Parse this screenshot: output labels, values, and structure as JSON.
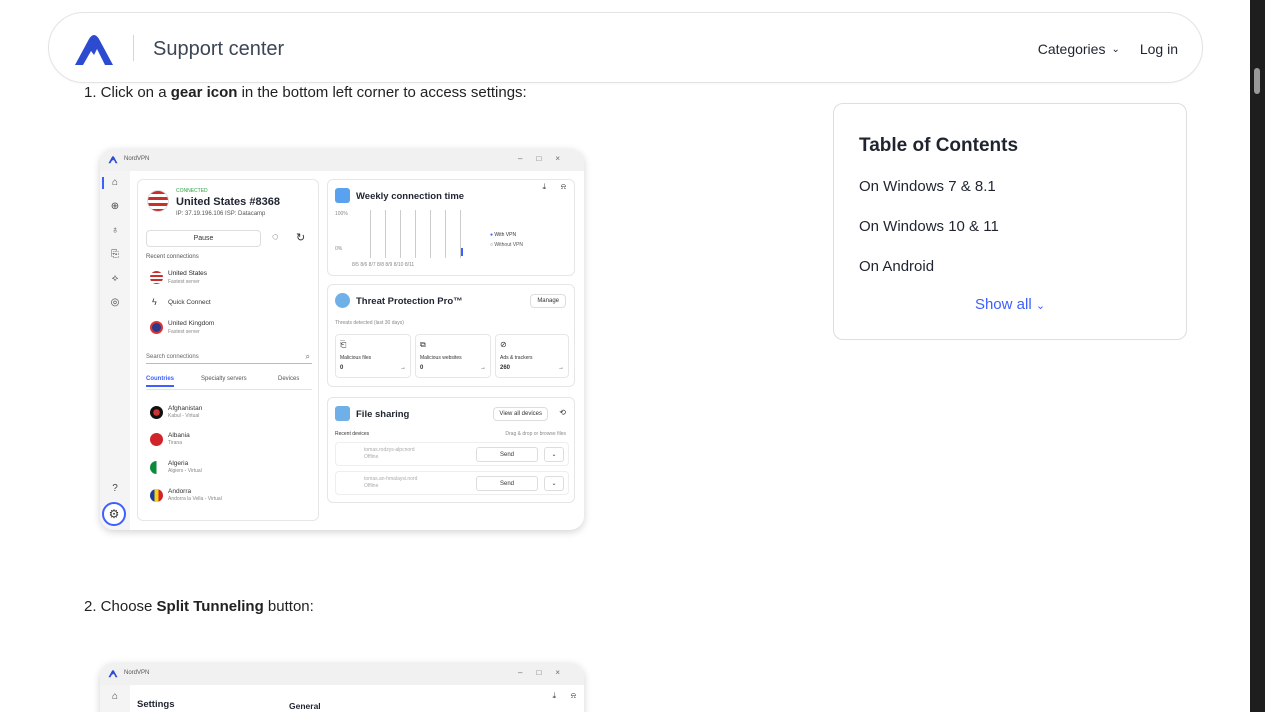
{
  "header": {
    "brand": "Support center",
    "categories": "Categories",
    "login": "Log in"
  },
  "steps": {
    "s1_pre": "1. Click on a ",
    "s1_bold": "gear icon",
    "s1_post": " in the bottom left corner to access settings:",
    "s2_pre": "2. Choose ",
    "s2_bold": "Split Tunneling",
    "s2_post": " button:"
  },
  "toc": {
    "title": "Table of Contents",
    "items": [
      "On Windows 7 & 8.1",
      "On Windows 10 & 11",
      "On Android"
    ],
    "show_all": "Show all"
  },
  "app1": {
    "title": "NordVPN",
    "status": "CONNECTED",
    "server": "United States #8368",
    "ip": "IP: 37.19.196.106   ISP: Datacamp",
    "pause": "Pause",
    "recent": "Recent connections",
    "rc1_name": "United States",
    "rc1_sub": "Fastest server",
    "quick": "Quick Connect",
    "rc2_name": "United Kingdom",
    "rc2_sub": "Fastest server",
    "search": "Search connections",
    "tabs": [
      "Countries",
      "Specialty servers",
      "Devices"
    ],
    "countries": [
      {
        "name": "Afghanistan",
        "sub": "Kabul - Virtual"
      },
      {
        "name": "Albania",
        "sub": "Tirana"
      },
      {
        "name": "Algeria",
        "sub": "Algiers - Virtual"
      },
      {
        "name": "Andorra",
        "sub": "Andorra la Vella - Virtual"
      }
    ],
    "weekly": "Weekly connection time",
    "p100": "100%",
    "p0": "0%",
    "days": "8/5   8/6   8/7   8/8   8/9   8/10   8/11",
    "with_vpn": "With VPN",
    "without_vpn": "Without VPN",
    "tp": "Threat Protection Pro™",
    "manage": "Manage",
    "threats": "Threats detected (last 30 days)",
    "mf": "Malicious files",
    "mf_v": "0",
    "mw": "Malicious websites",
    "mw_v": "0",
    "at": "Ads & trackers",
    "at_v": "260",
    "fs": "File sharing",
    "view_all": "View all devices",
    "recent_devices": "Recent devices",
    "drag": "Drag & drop or browse files",
    "dev1": "tomas.rodzys-alpcnord",
    "dev2": "tomas.an-hmalaysi.nord",
    "offline": "Offline",
    "send": "Send"
  },
  "app2": {
    "title": "NordVPN",
    "settings": "Settings",
    "general": "General"
  },
  "colors": {
    "accent": "#3e5fff",
    "connected": "#2ea043"
  }
}
